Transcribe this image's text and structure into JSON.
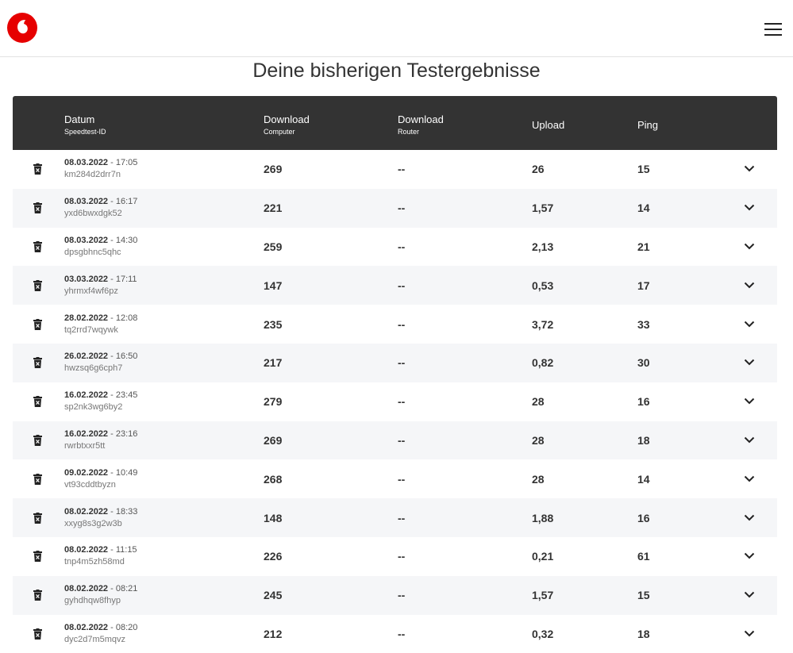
{
  "header": {
    "logo_icon": "vodafone-logo-icon",
    "menu_icon": "hamburger-menu-icon",
    "brand_color": "#e60000"
  },
  "page": {
    "title": "Deine bisherigen Testergebnisse"
  },
  "table": {
    "columns": {
      "date": "Datum",
      "date_sub": "Speedtest-ID",
      "download_computer": "Download",
      "download_computer_sub": "Computer",
      "download_router": "Download",
      "download_router_sub": "Router",
      "upload": "Upload",
      "ping": "Ping"
    },
    "rows": [
      {
        "date": "08.03.2022",
        "time": "17:05",
        "id": "km284d2drr7n",
        "download_computer": "269",
        "download_router": "--",
        "upload": "26",
        "ping": "15"
      },
      {
        "date": "08.03.2022",
        "time": "16:17",
        "id": "yxd6bwxdgk52",
        "download_computer": "221",
        "download_router": "--",
        "upload": "1,57",
        "ping": "14"
      },
      {
        "date": "08.03.2022",
        "time": "14:30",
        "id": "dpsgbhnc5qhc",
        "download_computer": "259",
        "download_router": "--",
        "upload": "2,13",
        "ping": "21"
      },
      {
        "date": "03.03.2022",
        "time": "17:11",
        "id": "yhrmxf4wf6pz",
        "download_computer": "147",
        "download_router": "--",
        "upload": "0,53",
        "ping": "17"
      },
      {
        "date": "28.02.2022",
        "time": "12:08",
        "id": "tq2rrd7wqywk",
        "download_computer": "235",
        "download_router": "--",
        "upload": "3,72",
        "ping": "33"
      },
      {
        "date": "26.02.2022",
        "time": "16:50",
        "id": "hwzsq6g6cph7",
        "download_computer": "217",
        "download_router": "--",
        "upload": "0,82",
        "ping": "30"
      },
      {
        "date": "16.02.2022",
        "time": "23:45",
        "id": "sp2nk3wg6by2",
        "download_computer": "279",
        "download_router": "--",
        "upload": "28",
        "ping": "16"
      },
      {
        "date": "16.02.2022",
        "time": "23:16",
        "id": "rwrbtxxr5tt",
        "download_computer": "269",
        "download_router": "--",
        "upload": "28",
        "ping": "18"
      },
      {
        "date": "09.02.2022",
        "time": "10:49",
        "id": "vt93cddtbyzn",
        "download_computer": "268",
        "download_router": "--",
        "upload": "28",
        "ping": "14"
      },
      {
        "date": "08.02.2022",
        "time": "18:33",
        "id": "xxyg8s3g2w3b",
        "download_computer": "148",
        "download_router": "--",
        "upload": "1,88",
        "ping": "16"
      },
      {
        "date": "08.02.2022",
        "time": "11:15",
        "id": "tnp4m5zh58md",
        "download_computer": "226",
        "download_router": "--",
        "upload": "0,21",
        "ping": "61"
      },
      {
        "date": "08.02.2022",
        "time": "08:21",
        "id": "gyhdhqw8fhyp",
        "download_computer": "245",
        "download_router": "--",
        "upload": "1,57",
        "ping": "15"
      },
      {
        "date": "08.02.2022",
        "time": "08:20",
        "id": "dyc2d7m5mqvz",
        "download_computer": "212",
        "download_router": "--",
        "upload": "0,32",
        "ping": "18"
      }
    ],
    "row_icons": {
      "delete": "trash-icon",
      "expand": "chevron-down-icon"
    },
    "date_time_separator": " - "
  }
}
